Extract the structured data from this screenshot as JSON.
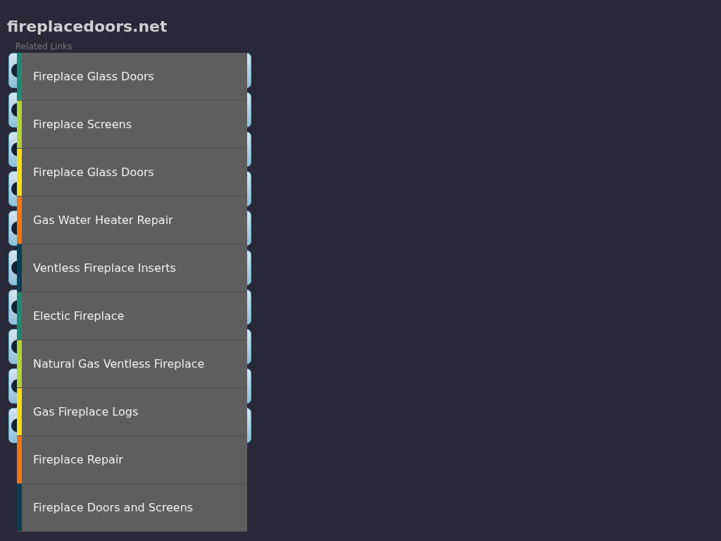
{
  "site_title": "fireplacedoors.net",
  "section_label": "Related Links",
  "links": [
    {
      "label": "Fireplace Glass Doors",
      "color": "#1e8a6e"
    },
    {
      "label": "Fireplace Screens",
      "color": "#b5d334"
    },
    {
      "label": "Fireplace Glass Doors",
      "color": "#f5dc1b"
    },
    {
      "label": "Gas Water Heater Repair",
      "color": "#f5750f"
    },
    {
      "label": "Ventless Fireplace Inserts",
      "color": "#063f52"
    },
    {
      "label": "Electic Fireplace",
      "color": "#1e8a6e"
    },
    {
      "label": "Natural Gas Ventless Fireplace",
      "color": "#b5d334"
    },
    {
      "label": "Gas Fireplace Logs",
      "color": "#f5dc1b"
    },
    {
      "label": "Fireplace Repair",
      "color": "#f5750f"
    },
    {
      "label": "Fireplace Doors and Screens",
      "color": "#063f52"
    }
  ]
}
